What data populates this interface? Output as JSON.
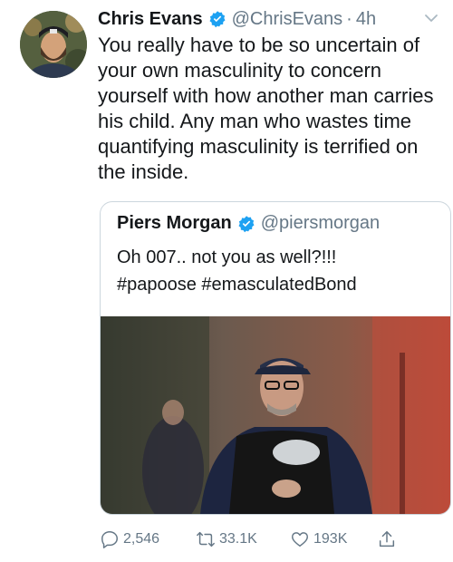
{
  "tweet": {
    "author_name": "Chris Evans",
    "author_handle": "@ChrisEvans",
    "separator": "·",
    "time": "4h",
    "text": "You really have to be so uncertain of your own masculinity to concern yourself with how another man carries his child. Any man who wastes time quantifying masculinity is terrified on the inside.",
    "verified": true
  },
  "quoted_tweet": {
    "author_name": "Piers Morgan",
    "author_handle": "@piersmorgan",
    "text_line1": "Oh 007.. not you as well?!!!",
    "text_line2": "#papoose #emasculatedBond",
    "verified": true
  },
  "actions": {
    "replies": "2,546",
    "retweets": "33.1K",
    "likes": "193K"
  },
  "icons": {
    "verified": "verified-badge-icon",
    "caret": "chevron-down-icon",
    "reply": "reply-icon",
    "retweet": "retweet-icon",
    "like": "heart-icon",
    "share": "share-icon"
  },
  "colors": {
    "verified": "#1da1f2",
    "secondary_text": "#657786",
    "border": "#ccd6dd"
  }
}
